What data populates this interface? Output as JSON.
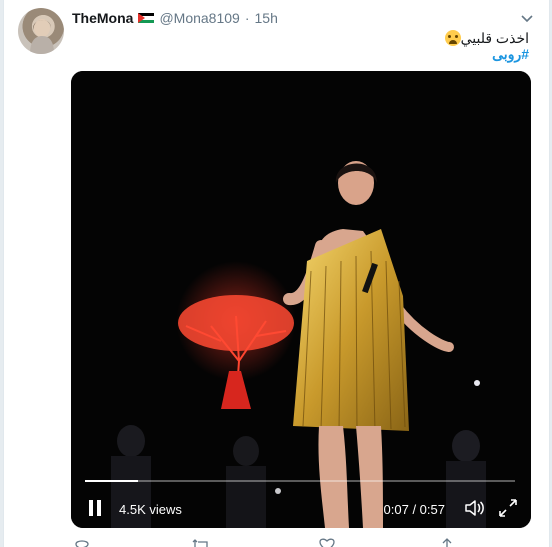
{
  "tweet": {
    "display_name": "TheMona",
    "handle": "@Mona8109",
    "separator": "·",
    "time": "15h",
    "text_line": "اخذت قلبيي",
    "hashtag": "#روبى",
    "emoji": "crying-face-emoji"
  },
  "video": {
    "views": "4.5K views",
    "timecode": "0:07 / 0:57",
    "progress": 0.123,
    "state": "playing"
  },
  "icons": {
    "pause": "pause-icon",
    "volume": "volume-icon",
    "fullscreen": "fullscreen-icon",
    "caret": "chevron-down-icon",
    "reply": "reply-icon",
    "retweet": "retweet-icon",
    "like": "heart-icon",
    "share": "share-icon"
  },
  "colors": {
    "link": "#1b95e0",
    "muted": "#657786",
    "video_bg": "#000000"
  }
}
